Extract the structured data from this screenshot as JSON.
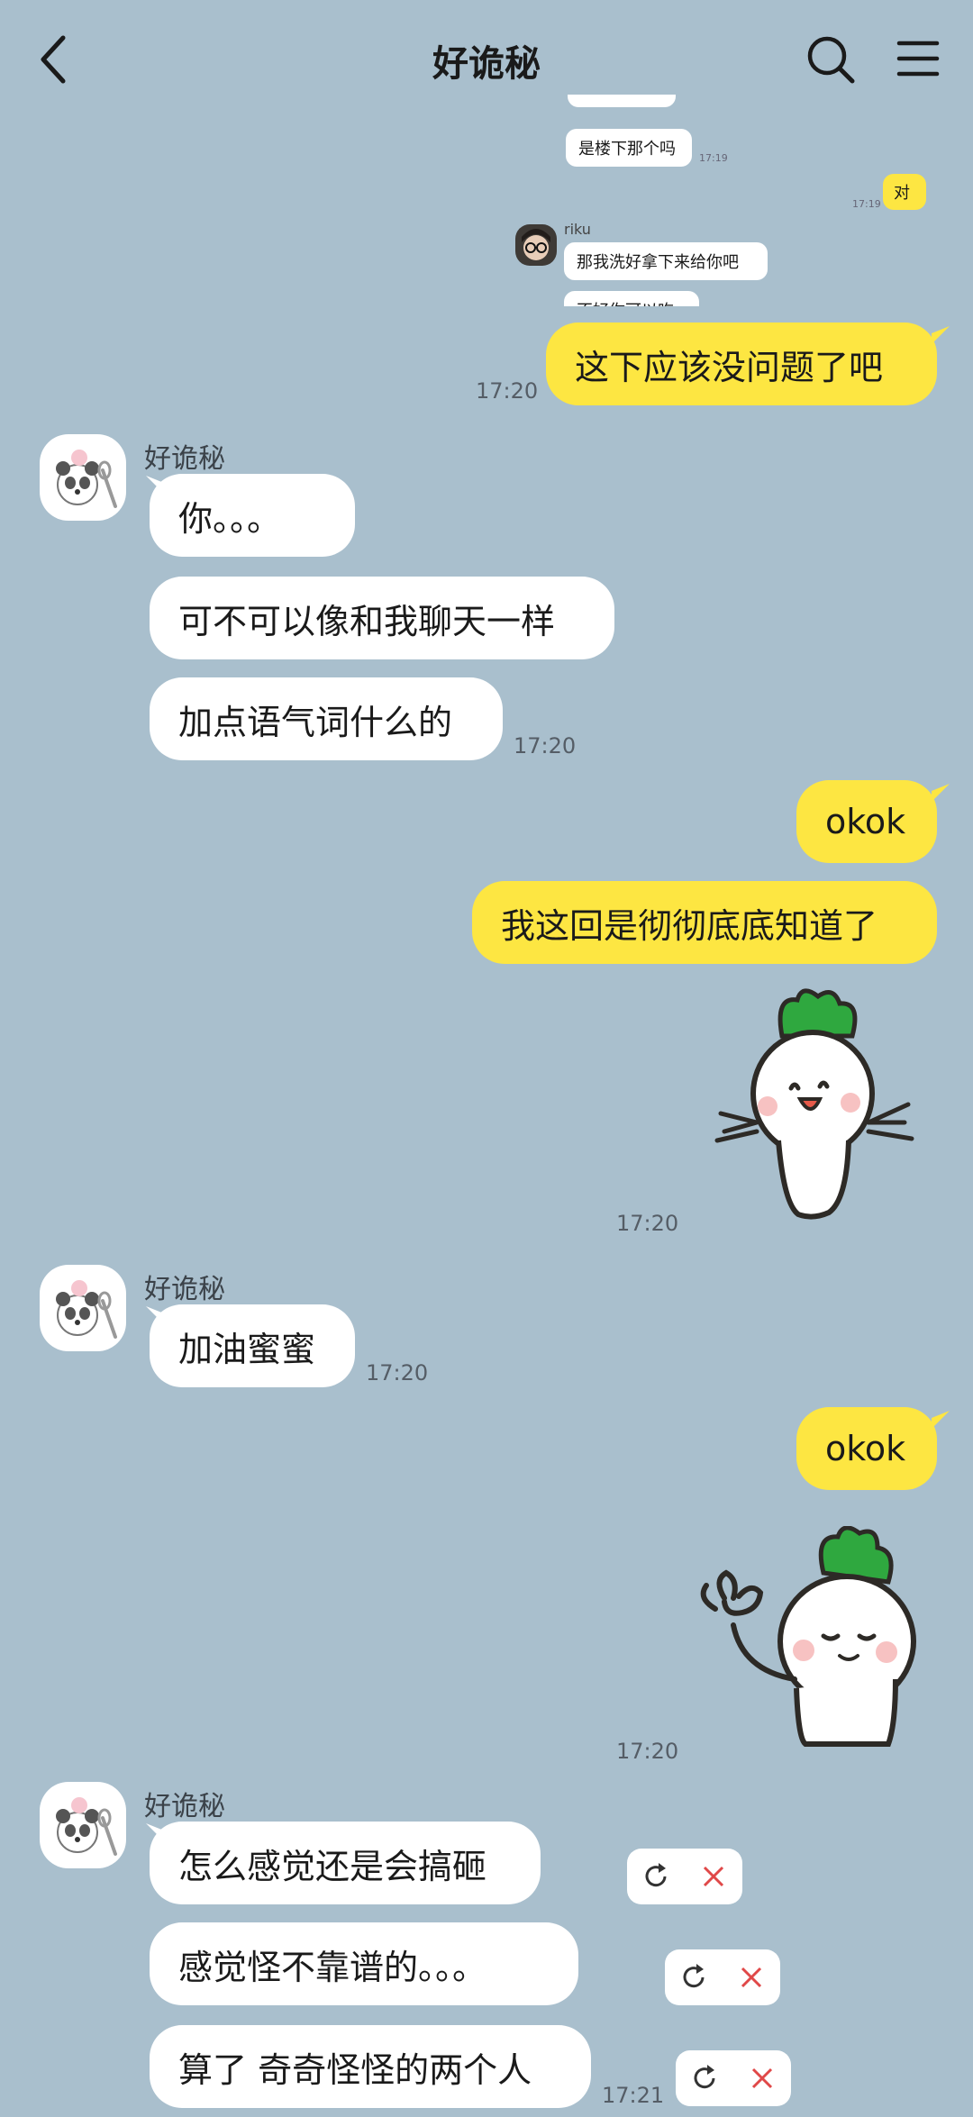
{
  "header": {
    "title": "好诡秘"
  },
  "quoted": {
    "msg1": "是楼下那个吗",
    "time1": "17:19",
    "reply": "对",
    "time2": "17:19",
    "sender": "riku",
    "msg2": "那我洗好拿下来给你吧",
    "msg3_partial": "不好你可以吃"
  },
  "messages": {
    "out1": {
      "text": "这下应该没问题了吧",
      "time": "17:20"
    },
    "in1": {
      "name": "好诡秘",
      "lines": [
        "你。。。",
        "可不可以像和我聊天一样",
        "加点语气词什么的"
      ],
      "time": "17:20"
    },
    "out2": {
      "lines": [
        "okok",
        "我这回是彻彻底底知道了"
      ],
      "sticker_time": "17:20"
    },
    "in2": {
      "name": "好诡秘",
      "text": "加油蜜蜜",
      "time": "17:20"
    },
    "out3": {
      "text": "okok",
      "sticker_time": "17:20"
    },
    "in3": {
      "name": "好诡秘",
      "lines": [
        "怎么感觉还是会搞砸",
        "感觉怪不靠谱的。。。",
        "算了 奇奇怪怪的两个人"
      ],
      "time": "17:21"
    }
  },
  "colors": {
    "background": "#a9bfcd",
    "outgoing": "#fde642",
    "incoming": "#ffffff"
  },
  "icons": [
    "back-icon",
    "search-icon",
    "menu-icon",
    "retry-icon",
    "delete-icon"
  ]
}
